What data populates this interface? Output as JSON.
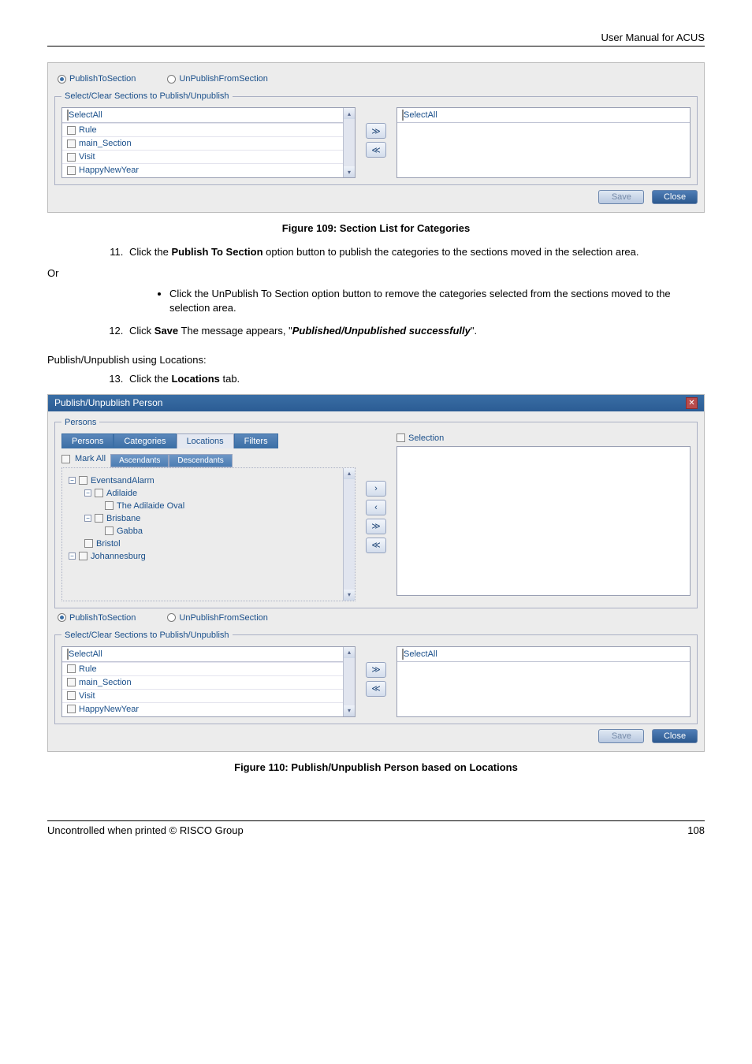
{
  "header": {
    "title": "User Manual for ACUS"
  },
  "fig1": {
    "radio_publish": "PublishToSection",
    "radio_unpublish": "UnPublishFromSection",
    "group_legend": "Select/Clear Sections to Publish/Unpublish",
    "left_selectall": "SelectAll",
    "right_selectall": "SelectAll",
    "items": [
      "Rule",
      "main_Section",
      "Visit",
      "HappyNewYear"
    ],
    "move_all_right": "≫",
    "move_all_left": "≪",
    "save": "Save",
    "close": "Close",
    "caption": "Figure 109: Section List for Categories"
  },
  "body_text": {
    "step11_no": "11.",
    "step11": "Click the ",
    "step11_bold": "Publish To Section",
    "step11_rest": " option button to publish the categories to the sections moved in the selection area.",
    "or": "Or",
    "bullet1": "Click the UnPublish To Section option button to remove the categories selected from the sections moved to the selection area.",
    "step12": "Click ",
    "step12_bold": "Save",
    "step12_mid": " The message appears, \"",
    "step12_ital": "Published/Unpublished successfully",
    "step12_end": "\".",
    "heading": "Publish/Unpublish using Locations:",
    "step13": "Click the ",
    "step13_bold": "Locations",
    "step13_end": " tab."
  },
  "fig2": {
    "title": "Publish/Unpublish Person",
    "persons_legend": "Persons",
    "tabs": {
      "persons": "Persons",
      "categories": "Categories",
      "locations": "Locations",
      "filters": "Filters"
    },
    "markall": "Mark All",
    "subtabs": {
      "asc": "Ascendants",
      "desc": "Descendants"
    },
    "tree": {
      "n1": "EventsandAlarm",
      "n1a": "Adilaide",
      "n1a1": "The Adilaide Oval",
      "n1b": "Brisbane",
      "n1b1": "Gabba",
      "n1c": "Bristol",
      "n2": "Johannesburg"
    },
    "selection_label": "Selection",
    "move_right": "›",
    "move_left": "‹",
    "move_all_right": "≫",
    "move_all_left": "≪",
    "radio_publish": "PublishToSection",
    "radio_unpublish": "UnPublishFromSection",
    "group_legend": "Select/Clear Sections to Publish/Unpublish",
    "left_selectall": "SelectAll",
    "right_selectall": "SelectAll",
    "items": [
      "Rule",
      "main_Section",
      "Visit",
      "HappyNewYear"
    ],
    "save": "Save",
    "close": "Close",
    "caption": "Figure 110: Publish/Unpublish Person based on Locations"
  },
  "footer": {
    "left": "Uncontrolled when printed © RISCO Group",
    "page": "108"
  }
}
